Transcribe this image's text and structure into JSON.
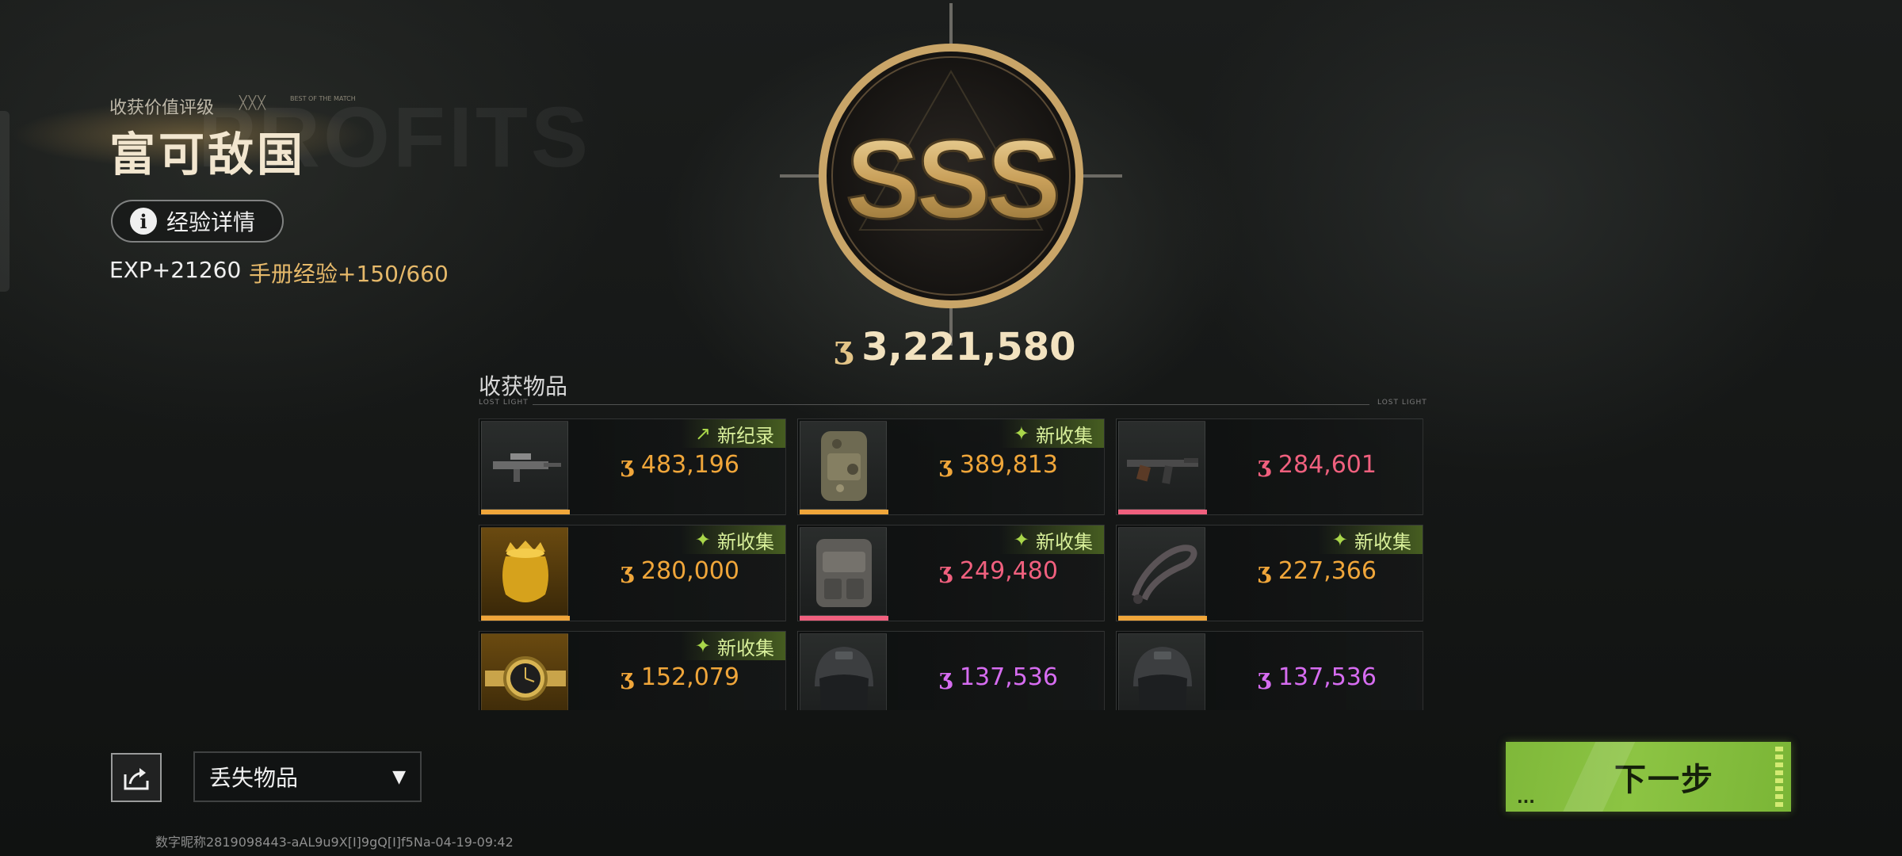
{
  "header": {
    "rating_label": "收获价值评级",
    "best_mark": "╳╳╳",
    "best_tiny": "BEST OF THE MATCH",
    "rating_title": "富可敌国",
    "faint_text": "PROFITS",
    "exp_detail_label": "经验详情",
    "exp_text": "EXP+21260",
    "handbook_text": "手册经验+150/660"
  },
  "emblem": {
    "rank": "SSS"
  },
  "total": {
    "currency_icon": "coin-icon",
    "currency_glyph": "ʒ",
    "value": "3,221,580"
  },
  "items_section": {
    "title": "收获物品",
    "sub_left": "LOST LIGHT",
    "sub_right": "LOST LIGHT",
    "items": [
      {
        "name": "rifle-scoped",
        "value": "483,196",
        "value_color": "#f0a63a",
        "rarity_color": "#f0a63a",
        "tag": "新纪录",
        "tag_icon": "↗"
      },
      {
        "name": "camo-backpack",
        "value": "389,813",
        "value_color": "#f0a63a",
        "rarity_color": "#f0a63a",
        "tag": "新收集",
        "tag_icon": "✦"
      },
      {
        "name": "ak-rifle",
        "value": "284,601",
        "value_color": "#f0607e",
        "rarity_color": "#f0607e",
        "tag": "",
        "tag_icon": ""
      },
      {
        "name": "golden-vase",
        "value": "280,000",
        "value_color": "#f0a63a",
        "rarity_color": "#f0a63a",
        "tag": "新收集",
        "tag_icon": "✦"
      },
      {
        "name": "tactical-backpack",
        "value": "249,480",
        "value_color": "#f0607e",
        "rarity_color": "#f0607e",
        "tag": "新收集",
        "tag_icon": "✦"
      },
      {
        "name": "cable-loop",
        "value": "227,366",
        "value_color": "#f0a63a",
        "rarity_color": "#f0a63a",
        "tag": "新收集",
        "tag_icon": "✦"
      },
      {
        "name": "gold-watch",
        "value": "152,079",
        "value_color": "#f0a63a",
        "rarity_color": "#f0a63a",
        "tag": "新收集",
        "tag_icon": "✦"
      },
      {
        "name": "combat-helmet",
        "value": "137,536",
        "value_color": "#d66cf0",
        "rarity_color": "#d66cf0",
        "tag": "",
        "tag_icon": ""
      },
      {
        "name": "combat-helmet",
        "value": "137,536",
        "value_color": "#d66cf0",
        "rarity_color": "#d66cf0",
        "tag": "",
        "tag_icon": ""
      }
    ]
  },
  "footer": {
    "lost_dropdown_label": "丢失物品",
    "next_button_label": "下一步",
    "next_button_dots": "...",
    "id_text": "数字昵称2819098443-aAL9u9X[I]9gQ[I]f5Na-04-19-09:42"
  },
  "colors": {
    "accent_green": "#8cc443",
    "gold": "#e3c487",
    "orange": "#f0a63a",
    "pink": "#f0607e",
    "purple": "#d66cf0"
  }
}
